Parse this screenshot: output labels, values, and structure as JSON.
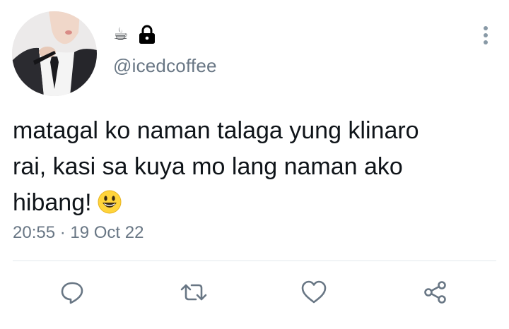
{
  "header": {
    "name_emoji": "☕",
    "locked": true,
    "handle": "@icedcoffee"
  },
  "tweet": {
    "text": "matagal ko naman talaga yung klinaro\nrai, kasi sa kuya mo lang naman ako\nhibang!",
    "trailing_emoji": "grinning-face",
    "timestamp": "20:55 · 19 Oct 22"
  },
  "icons": {
    "more": "vertical-ellipsis-icon",
    "actions": [
      "reply-icon",
      "retweet-icon",
      "like-icon",
      "share-icon"
    ]
  },
  "colors": {
    "text": "#0f1419",
    "secondary": "#687684",
    "divider": "#e1e8ed"
  }
}
